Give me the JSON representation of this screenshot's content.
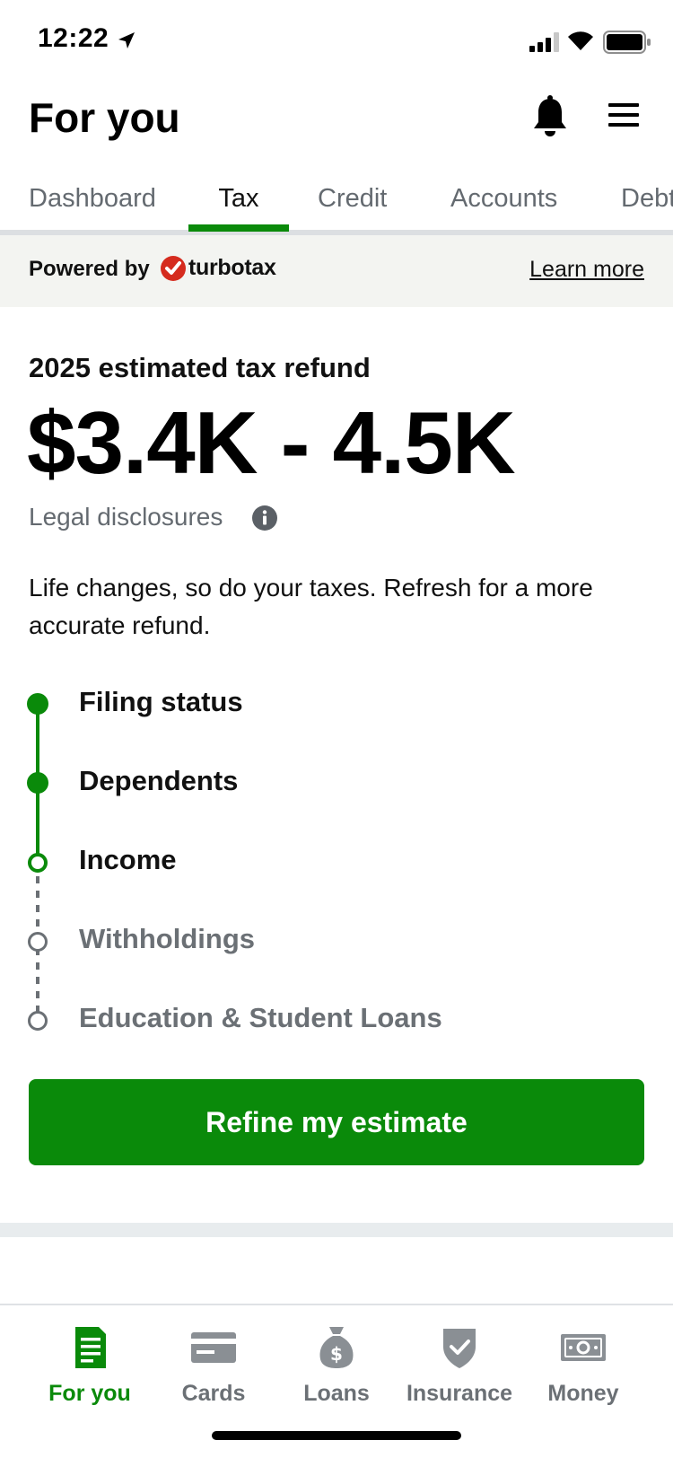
{
  "status_bar": {
    "time": "12:22"
  },
  "header": {
    "title": "For you"
  },
  "tabs": [
    {
      "label": "Dashboard"
    },
    {
      "label": "Tax"
    },
    {
      "label": "Credit"
    },
    {
      "label": "Accounts"
    },
    {
      "label": "Debt"
    }
  ],
  "powered": {
    "label": "Powered by",
    "brand": "turbotax",
    "learn_more": "Learn more"
  },
  "refund": {
    "label": "2025 estimated tax refund",
    "value": "$3.4K - 4.5K",
    "legal": "Legal disclosures",
    "description": "Life changes, so do your taxes. Refresh for a more accurate refund."
  },
  "steps": [
    {
      "label": "Filing status",
      "state": "complete"
    },
    {
      "label": "Dependents",
      "state": "complete"
    },
    {
      "label": "Income",
      "state": "current"
    },
    {
      "label": "Withholdings",
      "state": "pending"
    },
    {
      "label": "Education & Student Loans",
      "state": "pending"
    }
  ],
  "cta": {
    "label": "Refine my estimate"
  },
  "bottom_nav": [
    {
      "label": "For you",
      "active": true
    },
    {
      "label": "Cards",
      "active": false
    },
    {
      "label": "Loans",
      "active": false
    },
    {
      "label": "Insurance",
      "active": false
    },
    {
      "label": "Money",
      "active": false
    }
  ],
  "colors": {
    "brand_green": "#0a8a0a",
    "turbotax_red": "#d52b1e",
    "muted_gray": "#6b7075"
  }
}
